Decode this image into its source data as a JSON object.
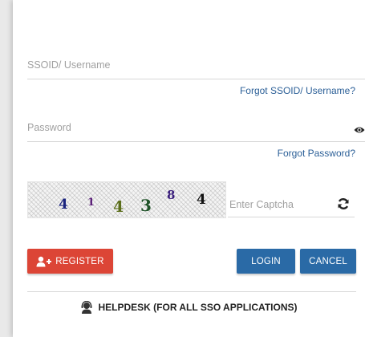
{
  "login": {
    "username_placeholder": "SSOID/ Username",
    "forgot_username": "Forgot SSOID/ Username?",
    "password_placeholder": "Password",
    "forgot_password": "Forgot Password?",
    "captcha_chars": [
      "4",
      "1",
      "4",
      "3",
      "8",
      "4"
    ],
    "captcha_placeholder": "Enter Captcha",
    "register_label": "REGISTER",
    "login_label": "LOGIN",
    "cancel_label": "CANCEL",
    "helpdesk_label": "HELPDESK (FOR ALL SSO APPLICATIONS)"
  },
  "colors": {
    "register": "#dc4536",
    "primary": "#2a6aa6",
    "link": "#2b5f97"
  },
  "icons": [
    "eye-icon",
    "refresh-icon",
    "add-user-icon",
    "helpdesk-agent-icon"
  ]
}
